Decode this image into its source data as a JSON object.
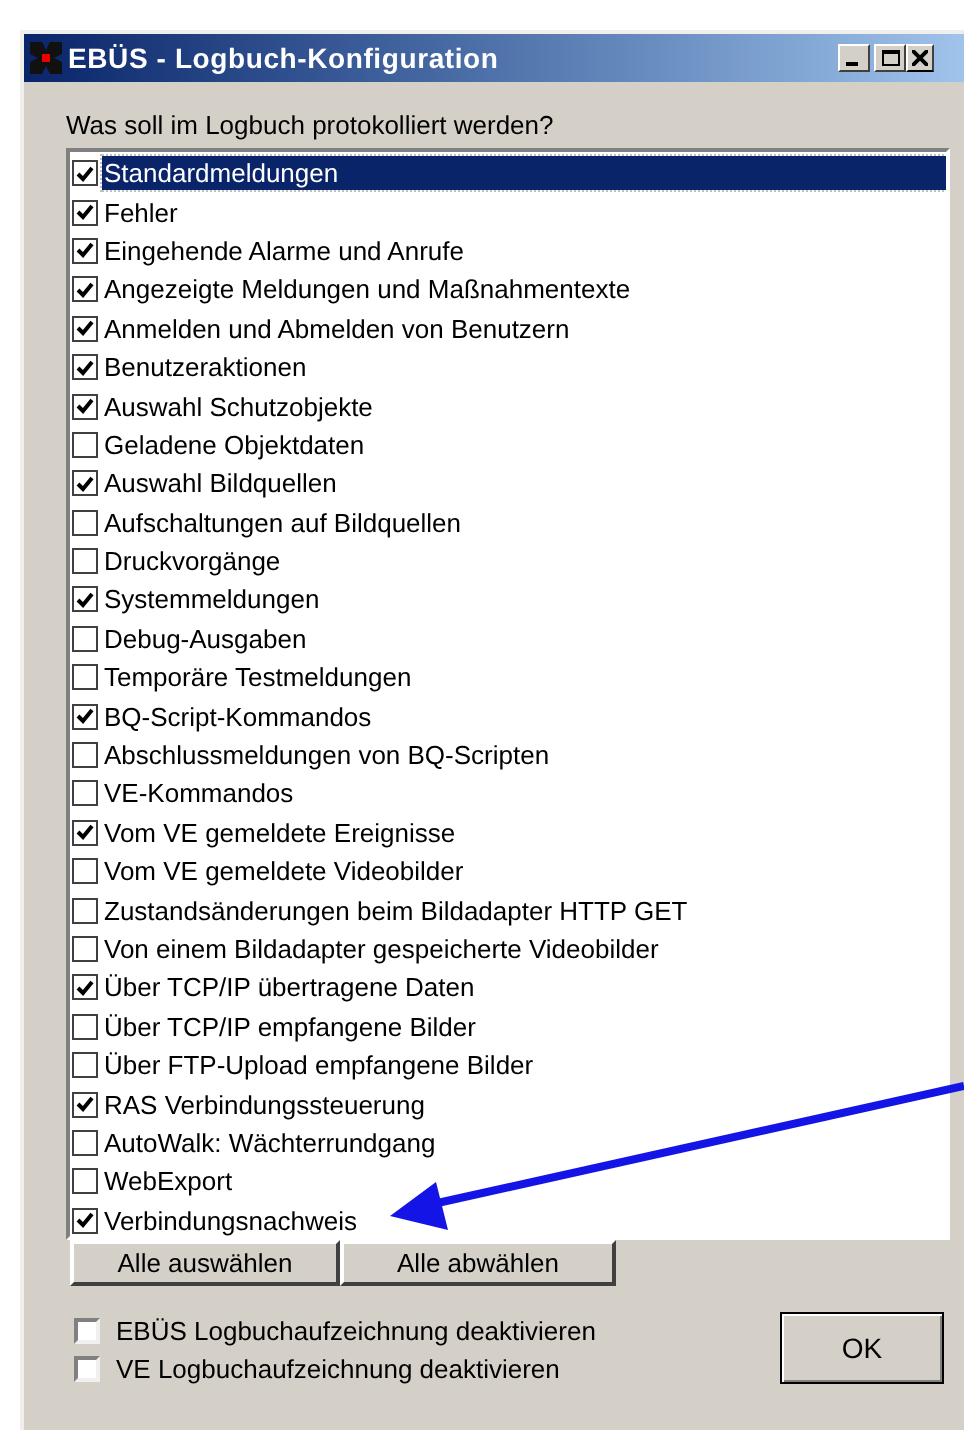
{
  "window": {
    "title": "EBÜS - Logbuch-Konfiguration"
  },
  "prompt": "Was soll im Logbuch protokolliert werden?",
  "log_items": [
    {
      "label": "Standardmeldungen",
      "checked": true,
      "selected": true
    },
    {
      "label": "Fehler",
      "checked": true,
      "selected": false
    },
    {
      "label": "Eingehende Alarme und Anrufe",
      "checked": true,
      "selected": false
    },
    {
      "label": "Angezeigte Meldungen und Maßnahmentexte",
      "checked": true,
      "selected": false
    },
    {
      "label": "Anmelden und Abmelden von Benutzern",
      "checked": true,
      "selected": false
    },
    {
      "label": "Benutzeraktionen",
      "checked": true,
      "selected": false
    },
    {
      "label": "Auswahl Schutzobjekte",
      "checked": true,
      "selected": false
    },
    {
      "label": "Geladene Objektdaten",
      "checked": false,
      "selected": false
    },
    {
      "label": "Auswahl Bildquellen",
      "checked": true,
      "selected": false
    },
    {
      "label": "Aufschaltungen auf Bildquellen",
      "checked": false,
      "selected": false
    },
    {
      "label": "Druckvorgänge",
      "checked": false,
      "selected": false
    },
    {
      "label": "Systemmeldungen",
      "checked": true,
      "selected": false
    },
    {
      "label": "Debug-Ausgaben",
      "checked": false,
      "selected": false
    },
    {
      "label": "Temporäre Testmeldungen",
      "checked": false,
      "selected": false
    },
    {
      "label": "BQ-Script-Kommandos",
      "checked": true,
      "selected": false
    },
    {
      "label": "Abschlussmeldungen von BQ-Scripten",
      "checked": false,
      "selected": false
    },
    {
      "label": "VE-Kommandos",
      "checked": false,
      "selected": false
    },
    {
      "label": "Vom VE gemeldete Ereignisse",
      "checked": true,
      "selected": false
    },
    {
      "label": "Vom VE gemeldete Videobilder",
      "checked": false,
      "selected": false
    },
    {
      "label": "Zustandsänderungen beim Bildadapter HTTP GET",
      "checked": false,
      "selected": false
    },
    {
      "label": "Von einem Bildadapter gespeicherte Videobilder",
      "checked": false,
      "selected": false
    },
    {
      "label": "Über TCP/IP übertragene Daten",
      "checked": true,
      "selected": false
    },
    {
      "label": "Über TCP/IP empfangene Bilder",
      "checked": false,
      "selected": false
    },
    {
      "label": "Über FTP-Upload empfangene Bilder",
      "checked": false,
      "selected": false
    },
    {
      "label": "RAS Verbindungssteuerung",
      "checked": true,
      "selected": false
    },
    {
      "label": "AutoWalk: Wächterrundgang",
      "checked": false,
      "selected": false
    },
    {
      "label": "WebExport",
      "checked": false,
      "selected": false
    },
    {
      "label": "Verbindungsnachweis",
      "checked": true,
      "selected": false
    }
  ],
  "list_buttons": [
    "Alle auswählen",
    "Alle abwählen"
  ],
  "options": [
    {
      "label": "EBÜS Logbuchaufzeichnung deaktivieren",
      "checked": false
    },
    {
      "label": "VE Logbuchaufzeichnung deaktivieren",
      "checked": false
    }
  ],
  "ok_button": "OK"
}
